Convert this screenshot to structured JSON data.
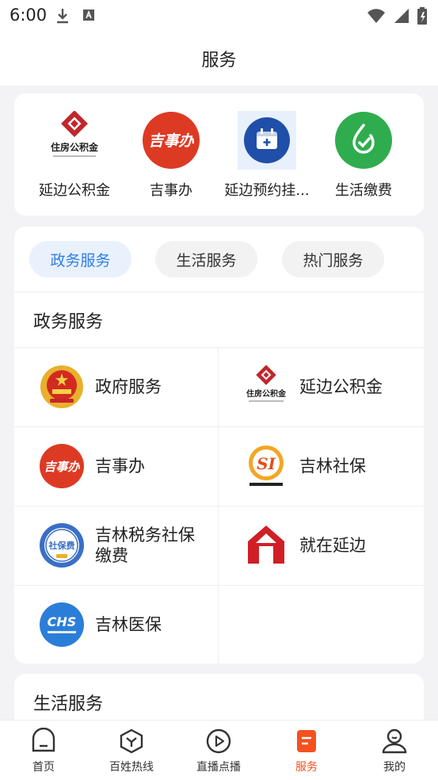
{
  "status_bar": {
    "time": "6:00"
  },
  "header": {
    "title": "服务"
  },
  "shortcuts": [
    {
      "label": "延边公积金",
      "icon": "housing-fund-logo"
    },
    {
      "label": "吉事办",
      "icon": "jishiban-logo"
    },
    {
      "label": "延边预约挂...",
      "icon": "calendar-plus-icon"
    },
    {
      "label": "生活缴费",
      "icon": "leaf-drop-icon"
    }
  ],
  "tabs": [
    {
      "label": "政务服务",
      "active": true
    },
    {
      "label": "生活服务",
      "active": false
    },
    {
      "label": "热门服务",
      "active": false
    }
  ],
  "government_services": {
    "title": "政务服务",
    "items": [
      {
        "label": "政府服务",
        "icon": "national-emblem-icon"
      },
      {
        "label": "延边公积金",
        "icon": "housing-fund-logo"
      },
      {
        "label": "吉事办",
        "icon": "jishiban-logo"
      },
      {
        "label": "吉林社保",
        "icon": "social-insurance-logo"
      },
      {
        "label": "吉林税务社保缴费",
        "icon": "tax-social-insurance-badge"
      },
      {
        "label": "就在延边",
        "icon": "yanbian-logo"
      },
      {
        "label": "吉林医保",
        "icon": "chs-medical-insurance-logo"
      }
    ]
  },
  "life_services": {
    "title": "生活服务"
  },
  "bottom_nav": [
    {
      "label": "首页",
      "icon": "home-icon",
      "active": false
    },
    {
      "label": "百姓热线",
      "icon": "hotline-icon",
      "active": false
    },
    {
      "label": "直播点播",
      "icon": "play-icon",
      "active": false
    },
    {
      "label": "服务",
      "icon": "service-icon",
      "active": true
    },
    {
      "label": "我的",
      "icon": "profile-icon",
      "active": false
    }
  ],
  "colors": {
    "accent": "#f4511e",
    "tab_active": "#2f7fe6",
    "tab_active_bg": "#e9f1fd"
  },
  "jishiban_logo_text": "吉事办",
  "chs_logo_text": "CHS",
  "tax_badge_text": "社保费",
  "housing_fund_logo_text": "住房公积金",
  "social_logo_text": "SI"
}
